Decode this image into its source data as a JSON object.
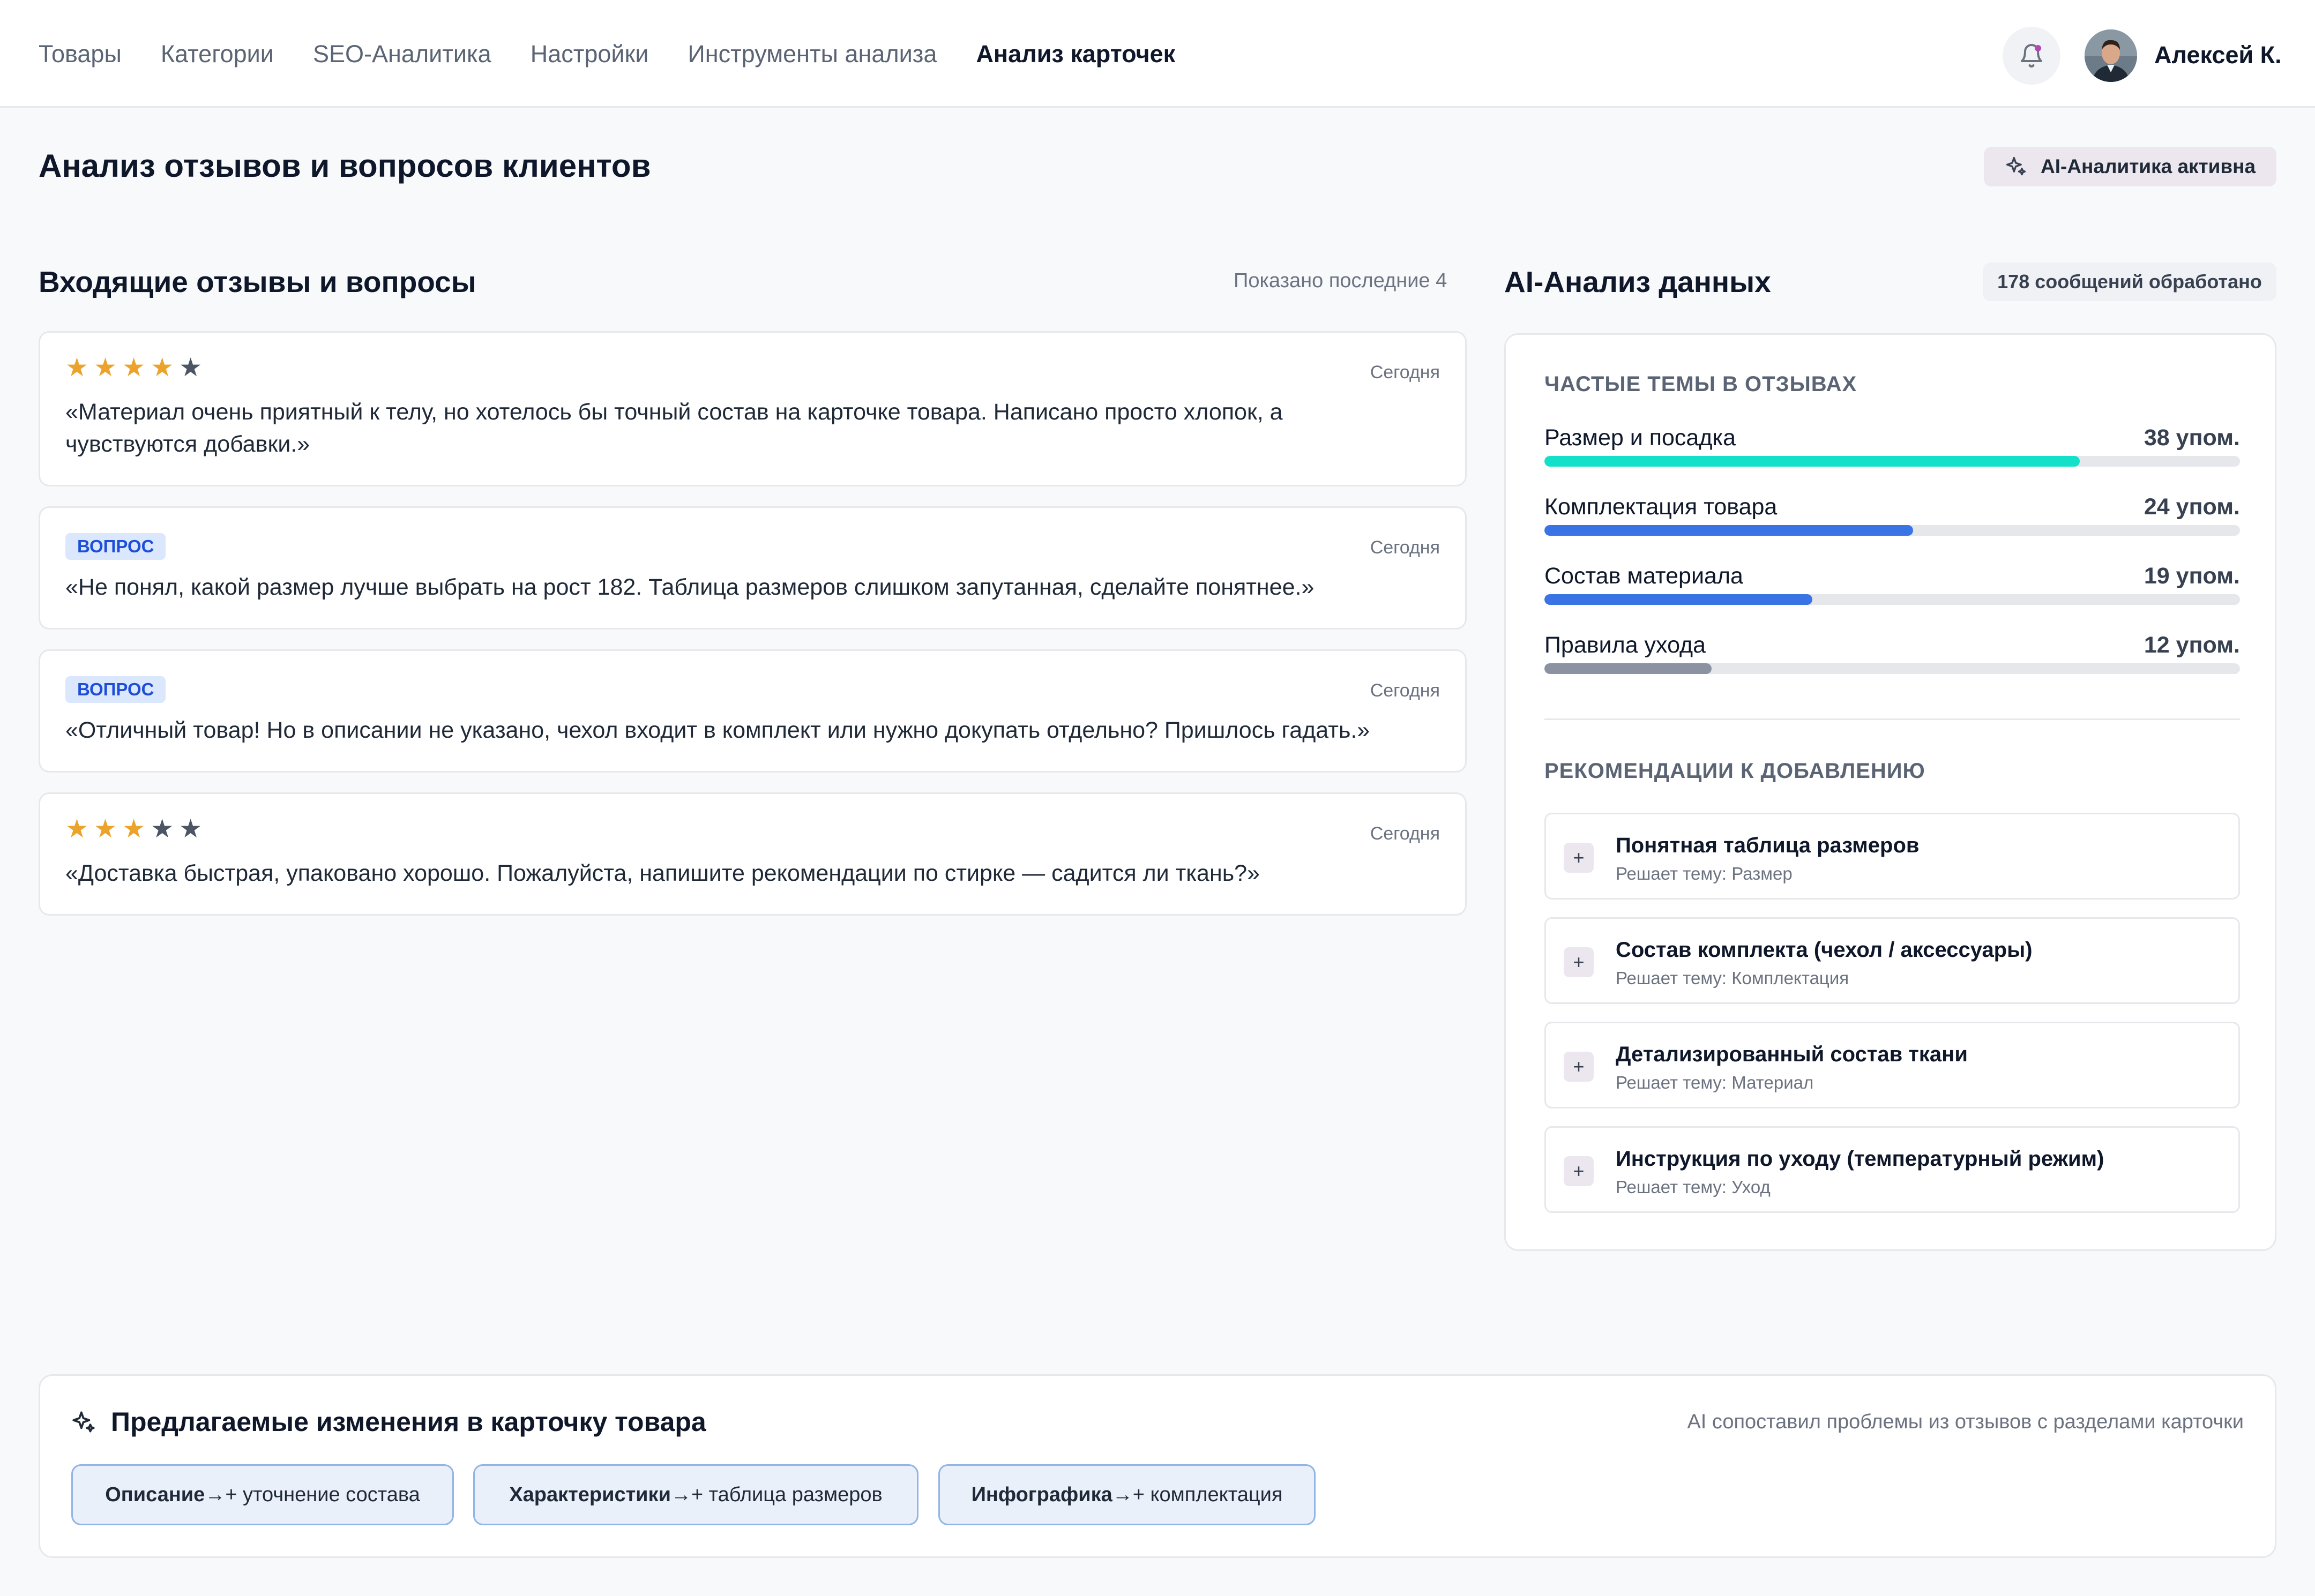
{
  "nav": {
    "items": [
      {
        "label": "Товары",
        "active": false
      },
      {
        "label": "Категории",
        "active": false
      },
      {
        "label": "SEO-Аналитика",
        "active": false
      },
      {
        "label": "Настройки",
        "active": false
      },
      {
        "label": "Инструменты анализа",
        "active": false
      },
      {
        "label": "Анализ карточек",
        "active": true
      }
    ],
    "user_name": "Алексей К.",
    "bell_icon": "bell-icon"
  },
  "page": {
    "title": "Анализ отзывов и вопросов клиентов",
    "ai_badge": "AI-Аналитика активна"
  },
  "reviews": {
    "title": "Входящие отзывы и вопросы",
    "meta": "Показано последние 4",
    "items": [
      {
        "kind": "review",
        "rating": 4,
        "max_rating": 5,
        "date": "Сегодня",
        "text": "«Материал очень приятный к телу, но хотелось бы точный состав на карточке товара. Написано просто хлопок, а чувствуются добавки.»"
      },
      {
        "kind": "question",
        "tag": "ВОПРОС",
        "date": "Сегодня",
        "text": "«Не понял, какой размер лучше выбрать на рост 182. Таблица размеров слишком запутанная, сделайте понятнее.»"
      },
      {
        "kind": "question",
        "tag": "ВОПРОС",
        "date": "Сегодня",
        "text": "«Отличный товар! Но в описании не указано, чехол входит в комплект или нужно докупать отдельно? Пришлось гадать.»"
      },
      {
        "kind": "review",
        "rating": 3,
        "max_rating": 5,
        "date": "Сегодня",
        "text": "«Доставка быстрая, упаковано хорошо. Пожалуйста, напишите рекомендации по стирке — садится ли ткань?»"
      }
    ]
  },
  "ai": {
    "title": "AI-Анализ данных",
    "processed": "178 сообщений обработано",
    "topics_title": "ЧАСТЫЕ ТЕМЫ В ОТЗЫВАХ",
    "topics": [
      {
        "name": "Размер и посадка",
        "count": "38 упом.",
        "fill_fraction": 0.77,
        "color": "#13e0c8"
      },
      {
        "name": "Комплектация товара",
        "count": "24 упом.",
        "fill_fraction": 0.53,
        "color": "#3a73e4"
      },
      {
        "name": "Состав материала",
        "count": "19 упом.",
        "fill_fraction": 0.385,
        "color": "#3a73e4"
      },
      {
        "name": "Правила ухода",
        "count": "12 упом.",
        "fill_fraction": 0.24,
        "color": "#8b93a3"
      }
    ],
    "recs_title": "РЕКОМЕНДАЦИИ К ДОБАВЛЕНИЮ",
    "recs": [
      {
        "title": "Понятная таблица размеров",
        "sub": "Решает тему: Размер"
      },
      {
        "title": "Состав комплекта (чехол / аксессуары)",
        "sub": "Решает тему: Комплектация"
      },
      {
        "title": "Детализированный состав ткани",
        "sub": "Решает тему: Материал"
      },
      {
        "title": "Инструкция по уходу (температурный режим)",
        "sub": "Решает тему: Уход"
      }
    ]
  },
  "changes": {
    "title": "Предлагаемые изменения в карточку товара",
    "note": "AI сопоставил проблемы из отзывов с разделами карточки",
    "chips": [
      {
        "section": "Описание",
        "arrow": "→",
        "action": "+ уточнение состава"
      },
      {
        "section": "Характеристики",
        "arrow": "→",
        "action": "+ таблица размеров"
      },
      {
        "section": "Инфографика",
        "arrow": "→",
        "action": "+ комплектация"
      }
    ]
  },
  "colors": {
    "accent_teal": "#13e0c8",
    "accent_blue": "#3a73e4",
    "star": "#eba32c",
    "tag_text": "#1d4ed8"
  }
}
